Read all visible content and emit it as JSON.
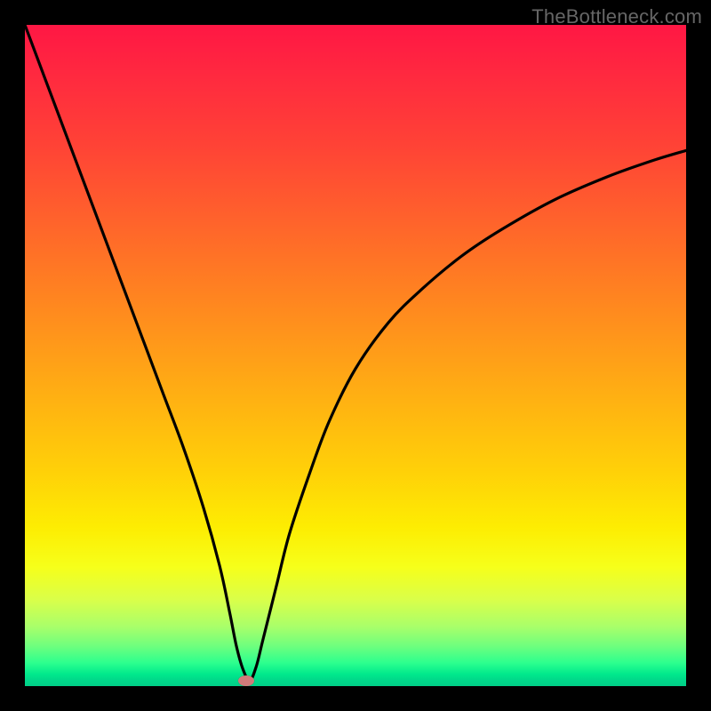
{
  "watermark": "TheBottleneck.com",
  "colors": {
    "page_bg": "#000000",
    "watermark_text": "#666666",
    "curve_stroke": "#000000",
    "marker_fill": "#d17a7a",
    "gradient_top": "#ff1744",
    "gradient_bottom": "#00cf88"
  },
  "chart_data": {
    "type": "line",
    "title": "",
    "xlabel": "",
    "ylabel": "",
    "xlim": [
      0,
      100
    ],
    "ylim": [
      0,
      100
    ],
    "grid": false,
    "legend": false,
    "series": [
      {
        "name": "bottleneck-curve",
        "x": [
          0,
          3,
          6,
          9,
          12,
          15,
          18,
          21,
          24,
          27,
          29.5,
          31,
          32,
          33,
          34,
          35,
          36,
          38,
          40,
          43,
          46,
          50,
          55,
          60,
          66,
          72,
          80,
          88,
          95,
          100
        ],
        "y": [
          100,
          92,
          84,
          76,
          68,
          60,
          52,
          44,
          36,
          27,
          18,
          11,
          6,
          2.5,
          0.8,
          3,
          7,
          15,
          23,
          32,
          40,
          48,
          55,
          60,
          65,
          69,
          73.5,
          77,
          79.5,
          81
        ]
      }
    ],
    "annotations": [
      {
        "name": "optimal-point-marker",
        "kind": "marker",
        "x": 33.5,
        "y": 0.8,
        "shape": "ellipse",
        "color": "#d17a7a"
      }
    ],
    "background": {
      "type": "vertical-gradient",
      "meaning": "bottleneck severity (red=high, green=low)",
      "stops": [
        "#ff1744",
        "#ff981a",
        "#fded02",
        "#00cf88"
      ]
    }
  }
}
